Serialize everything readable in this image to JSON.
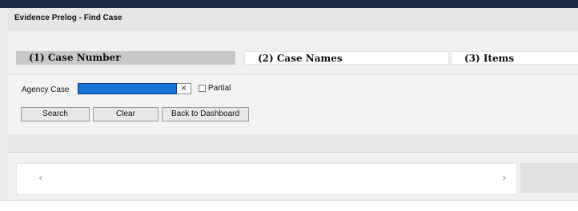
{
  "window": {
    "title": "Evidence Prelog - Find Case"
  },
  "tabs": [
    {
      "label": "(1) Case Number",
      "active": true
    },
    {
      "label": "(2) Case Names",
      "active": false
    },
    {
      "label": "(3) Items",
      "active": false
    }
  ],
  "search": {
    "agency_case_label": "Agency Case",
    "agency_case_value": "",
    "clear_icon": "×",
    "partial_label": "Partial",
    "partial_checked": false
  },
  "buttons": {
    "search_label": "Search",
    "clear_label": "Clear",
    "back_label": "Back to Dashboard"
  },
  "scroller": {
    "left_arrow": "‹",
    "right_arrow": "›"
  },
  "colors": {
    "selection_blue": "#1a73d9",
    "active_tab": "#c8c8c8",
    "top_bar": "#1b2a44"
  }
}
